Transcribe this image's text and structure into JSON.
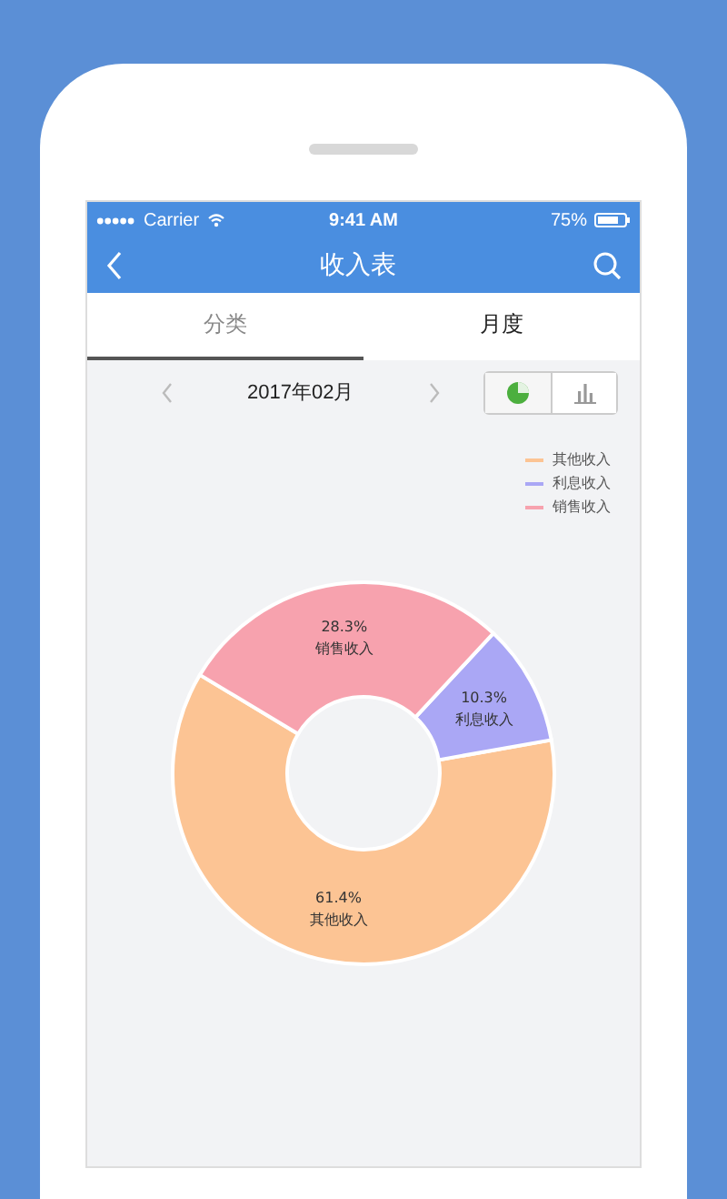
{
  "status_bar": {
    "carrier": "Carrier",
    "time": "9:41 AM",
    "battery": "75%"
  },
  "nav_bar": {
    "title": "收入表"
  },
  "tabs": [
    {
      "label": "分类",
      "selected": true
    },
    {
      "label": "月度",
      "selected": false
    }
  ],
  "period": {
    "value": "2017年02月"
  },
  "view_toggle": [
    {
      "kind": "pie",
      "selected": true
    },
    {
      "kind": "bar",
      "selected": false
    }
  ],
  "chart_data": {
    "type": "donut",
    "categories": [
      "其他收入",
      "利息收入",
      "销售收入"
    ],
    "values": [
      61.4,
      10.3,
      28.3
    ],
    "colors": [
      "#fcc494",
      "#aaa7f5",
      "#f7a2ae"
    ],
    "value_labels": [
      "61.4%",
      "10.3%",
      "28.3%"
    ],
    "legend": "top-right"
  }
}
